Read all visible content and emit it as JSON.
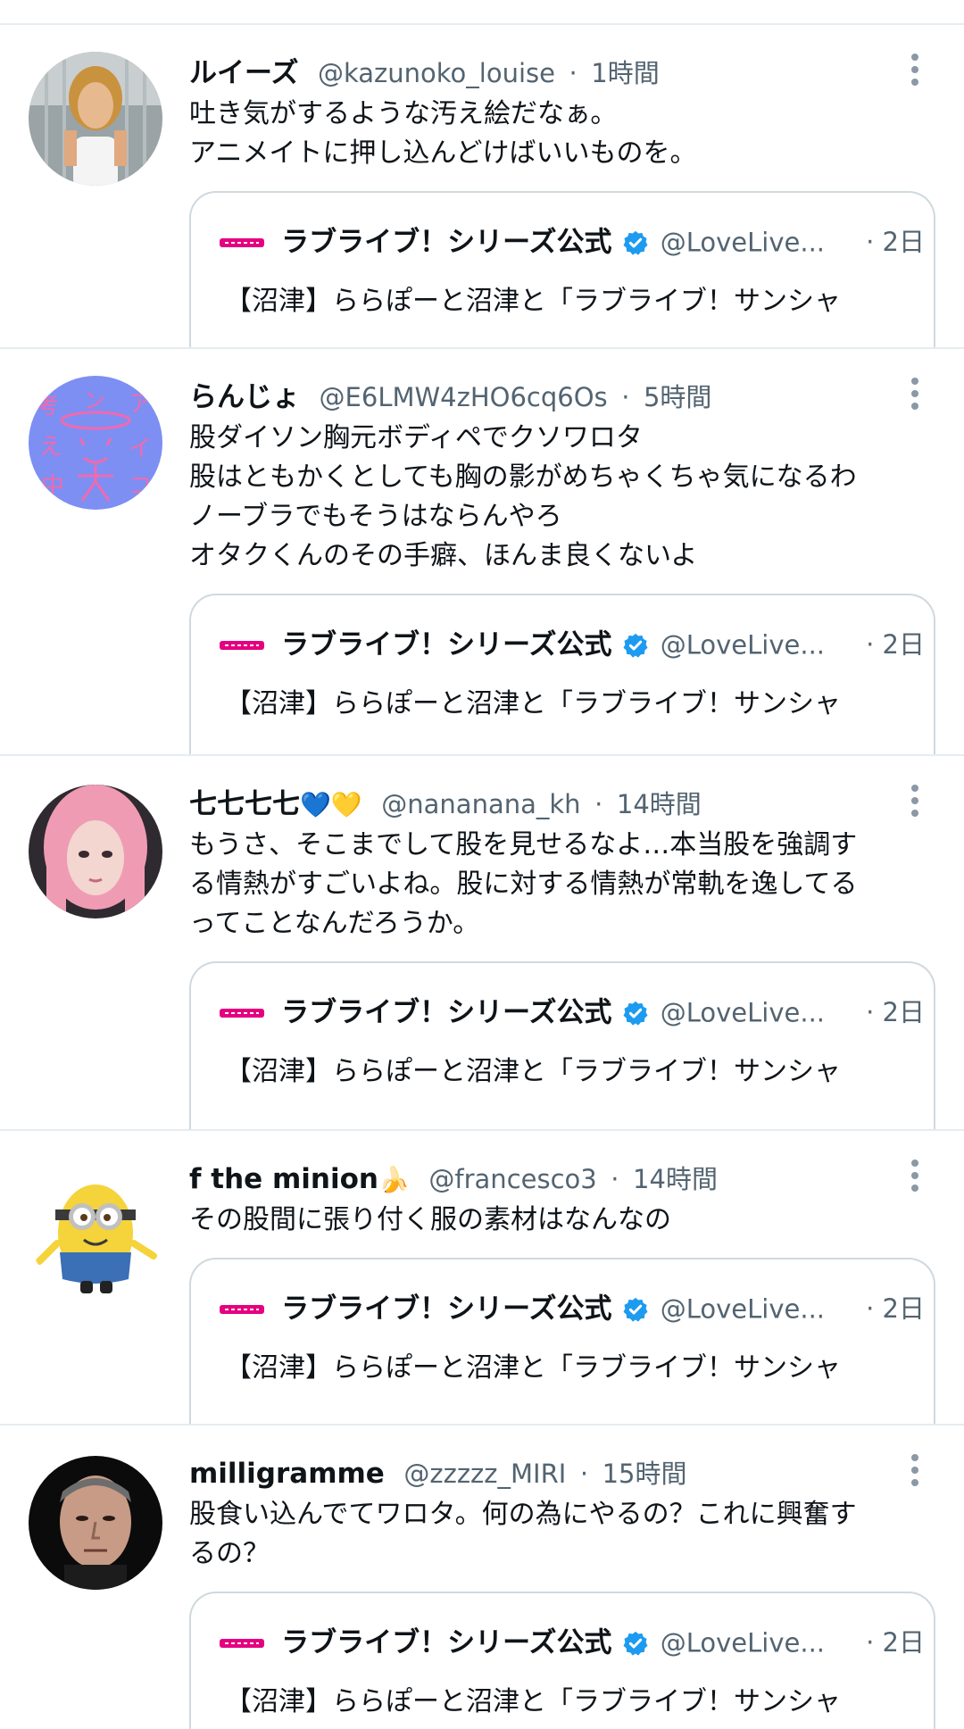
{
  "tweets": [
    {
      "display_name": "ルイーズ",
      "name_emoji": "",
      "handle": "@kazunoko_louise",
      "time": "1時間",
      "lines": [
        "吐き気がするような汚え絵だなぁ。",
        "アニメイトに押し込んどけばいいものを。"
      ],
      "avatar_icon": "user-photo-blonde-woman"
    },
    {
      "display_name": "らんじょ",
      "name_emoji": "",
      "handle": "@E6LMW4zHO6cq6Os",
      "time": "5時間",
      "lines": [
        "股ダイソン胸元ボディペでクソワロタ",
        "股はともかくとしても胸の影がめちゃくちゃ気になるわ",
        "ノーブラでもそうはならんやろ",
        "オタクくんのその手癖、ほんま良くないよ"
      ],
      "avatar_icon": "doodle-drawing-avatar",
      "avatar_text": [
        "考",
        "ン",
        "ア",
        "え",
        "イ",
        "中",
        "コ"
      ]
    },
    {
      "display_name": "七七七七",
      "name_emoji": "💙💛",
      "handle": "@nananana_kh",
      "time": "14時間",
      "lines": [
        "もうさ、そこまでして股を見せるなよ…本当股を強調す",
        "る情熱がすごいよね。股に対する情熱が常軌を逸してる",
        "ってことなんだろうか。"
      ],
      "avatar_icon": "user-photo-pink-hair"
    },
    {
      "display_name": "f the minion",
      "name_emoji": "🍌",
      "handle": "@francesco3",
      "time": "14時間",
      "lines": [
        "その股間に張り付く服の素材はなんなの"
      ],
      "avatar_icon": "minion-character"
    },
    {
      "display_name": "milligramme",
      "name_emoji": "",
      "handle": "@zzzzz_MIRI",
      "time": "15時間",
      "lines": [
        "股食い込んでてワロタ。何の為にやるの？これに興奮す",
        "るの？"
      ],
      "avatar_icon": "user-photo-man-portrait"
    }
  ],
  "quote": {
    "name": "ラブライブ！シリーズ公式",
    "handle": "@LoveLive...",
    "dot": "·",
    "time": "2日",
    "text": "【沼津】ららぽーと沼津と「ラブライブ！サンシャ",
    "logo_icon": "lovelive-logo-icon",
    "verified_icon": "verified-badge-icon"
  },
  "colors": {
    "text_primary": "#0f1419",
    "text_secondary": "#536471",
    "border": "#cfd9de",
    "divider": "#e6ecf0",
    "verified_blue": "#1d9bf0",
    "logo_pink": "#e4007f"
  },
  "dot_separator": "·",
  "more_icon": "more-vertical-icon"
}
